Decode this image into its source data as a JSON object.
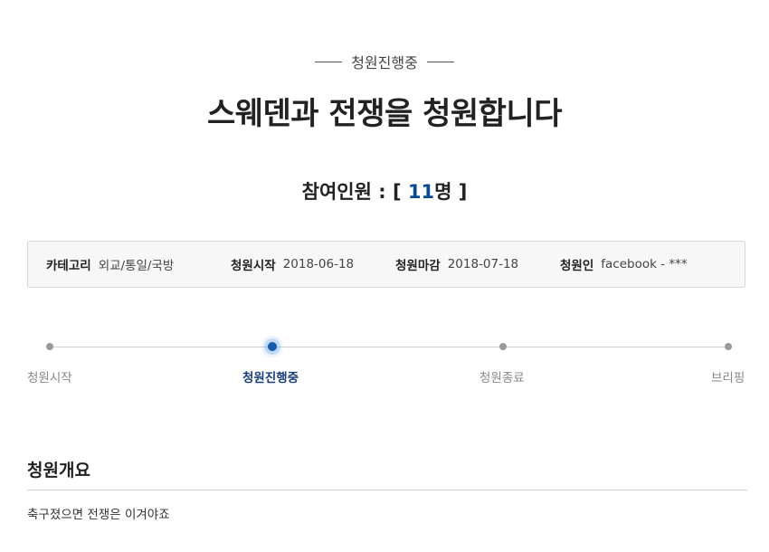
{
  "status": {
    "label": "청원진행중"
  },
  "petition": {
    "title": "스웨덴과 전쟁을 청원합니다",
    "participants_prefix": "참여인원 : [ ",
    "participants_count": "11",
    "participants_suffix": "명 ]"
  },
  "info": {
    "category_label": "카테고리",
    "category_value": "외교/통일/국방",
    "start_label": "청원시작",
    "start_value": "2018-06-18",
    "end_label": "청원마감",
    "end_value": "2018-07-18",
    "author_label": "청원인",
    "author_value": "facebook - ***"
  },
  "progress": {
    "steps": [
      {
        "label": "청원시작"
      },
      {
        "label": "청원진행중"
      },
      {
        "label": "청원종료"
      },
      {
        "label": "브리핑"
      }
    ],
    "active_index": 1
  },
  "overview": {
    "title": "청원개요",
    "body": "축구졌으면 전쟁은 이겨야죠"
  },
  "colors": {
    "accent": "#1b58b0",
    "count": "#0a4a92"
  }
}
